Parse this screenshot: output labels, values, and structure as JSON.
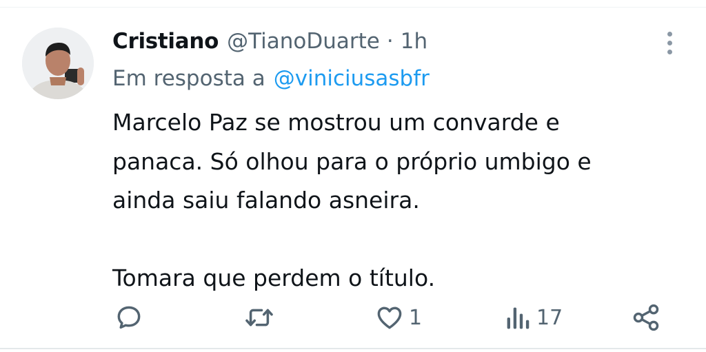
{
  "tweet": {
    "display_name": "Cristiano",
    "handle": "@TianoDuarte",
    "separator": "·",
    "time": "1h",
    "reply_prefix": "Em resposta a",
    "reply_to": "@viniciusasbfr",
    "body_lines": [
      "Marcelo Paz se mostrou um convarde e",
      "panaca. Só olhou para o próprio umbigo e",
      "ainda saiu falando asneira.",
      "Tomara que perdem o título."
    ]
  },
  "actions": {
    "reply": {
      "icon": "reply-icon"
    },
    "retweet": {
      "icon": "retweet-icon"
    },
    "like": {
      "icon": "heart-icon",
      "count": "1"
    },
    "views": {
      "icon": "views-icon",
      "count": "17"
    },
    "share": {
      "icon": "share-icon"
    }
  },
  "colors": {
    "text_primary": "#0f1419",
    "text_secondary": "#536471",
    "link": "#1d9bf0"
  }
}
